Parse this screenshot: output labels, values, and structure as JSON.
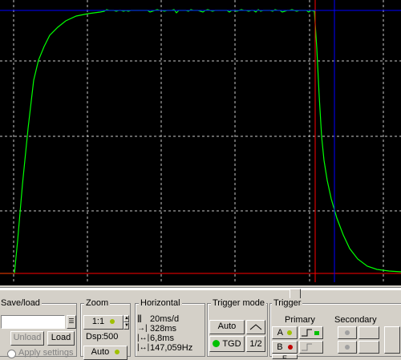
{
  "scope": {
    "background": "#000000",
    "grid_color": "#c8c8c8",
    "trace_color": "#00ff00",
    "cursor_time_color": "#ff0000",
    "cursor_horizontal_color": "#0000ff",
    "cursor_vertical_color": "#0000ff"
  },
  "save_load": {
    "title": "Save/load",
    "unload_label": "Unload",
    "load_label": "Load",
    "apply_label": "Apply settings"
  },
  "zoom": {
    "title": "Zoom",
    "ratio": "1:1",
    "dsp_label": "Dsp:",
    "dsp_value": "500",
    "auto_label": "Auto",
    "led_color": "#a0c000"
  },
  "horizontal": {
    "title": "Horizontal",
    "time_div": "20ms/d",
    "offset": "328ms",
    "delta_t": "6,8ms",
    "freq": "147,059Hz"
  },
  "trigger_mode": {
    "title": "Trigger mode",
    "auto_label": "Auto",
    "tgd_label": "TGD",
    "half_label": "1/2",
    "tgd_color": "#00c000"
  },
  "trigger": {
    "title": "Trigger",
    "primary_label": "Primary",
    "secondary_label": "Secondary",
    "channel_a": "A",
    "channel_b": "B",
    "channel_c": "E",
    "led_a": "#a0c000",
    "led_b": "#c00000"
  }
}
